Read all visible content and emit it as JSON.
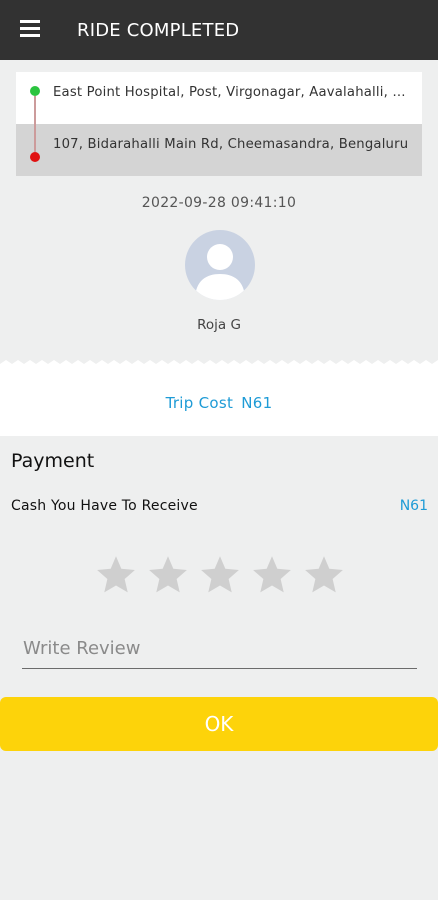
{
  "header": {
    "title": "RIDE COMPLETED",
    "menu_icon": "hamburger-menu-icon",
    "background": "#323232"
  },
  "route": {
    "pickup": "East Point Hospital, Post, Virgonagar, Aavalahalli, Bengaluru",
    "dropoff": "107, Bidarahalli Main Rd, Cheemasandra, Bengaluru",
    "pickup_dot_color": "#2bc43f",
    "dropoff_dot_color": "#e01010"
  },
  "ride": {
    "datetime": "2022-09-28 09:41:10",
    "driver_name": "Roja G",
    "avatar_icon": "person-avatar-icon"
  },
  "trip": {
    "label": "Trip Cost",
    "amount": "N61"
  },
  "payment": {
    "title": "Payment",
    "cash_label": "Cash You Have To Receive",
    "cash_amount": "N61"
  },
  "rating": {
    "max": 5,
    "value": 0,
    "star_icon": "star-icon"
  },
  "review": {
    "placeholder": "Write Review",
    "value": ""
  },
  "actions": {
    "ok_label": "OK"
  },
  "colors": {
    "accent_blue": "#1e9bd6",
    "ok_yellow": "#fdd30a",
    "star_gray": "#cfcfcf"
  }
}
